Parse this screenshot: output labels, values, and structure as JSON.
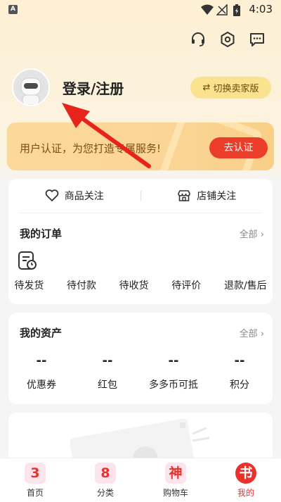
{
  "status_bar": {
    "app_badge": "A",
    "time": "4:03"
  },
  "header": {
    "login_text": "登录/注册",
    "switch_button": {
      "icon": "⇄",
      "label": "切换卖家版"
    }
  },
  "verify_banner": {
    "text": "用户认证，为您打造专属服务!",
    "button": "去认证"
  },
  "follow": {
    "goods": "商品关注",
    "store": "店铺关注"
  },
  "orders": {
    "title": "我的订单",
    "more": "全部",
    "items": [
      "待发货",
      "待付款",
      "待收货",
      "待评价",
      "退款/售后"
    ]
  },
  "assets": {
    "title": "我的资产",
    "more": "全部",
    "items": [
      {
        "value": "--",
        "label": "优惠券"
      },
      {
        "value": "--",
        "label": "红包"
      },
      {
        "value": "--",
        "label": "多多币可抵"
      },
      {
        "value": "--",
        "label": "积分"
      }
    ]
  },
  "tabbar": [
    {
      "glyph": "3",
      "label": "首页",
      "color": "#e8322b",
      "bg": "#fde3ec"
    },
    {
      "glyph": "8",
      "label": "分类",
      "color": "#e8322b",
      "bg": "#fde3ec"
    },
    {
      "glyph": "神",
      "label": "购物车",
      "color": "#e8322b",
      "bg": "#fde3ec"
    },
    {
      "glyph": "书",
      "label": "我的",
      "color": "#ffffff",
      "bg": "#e8322b"
    }
  ]
}
